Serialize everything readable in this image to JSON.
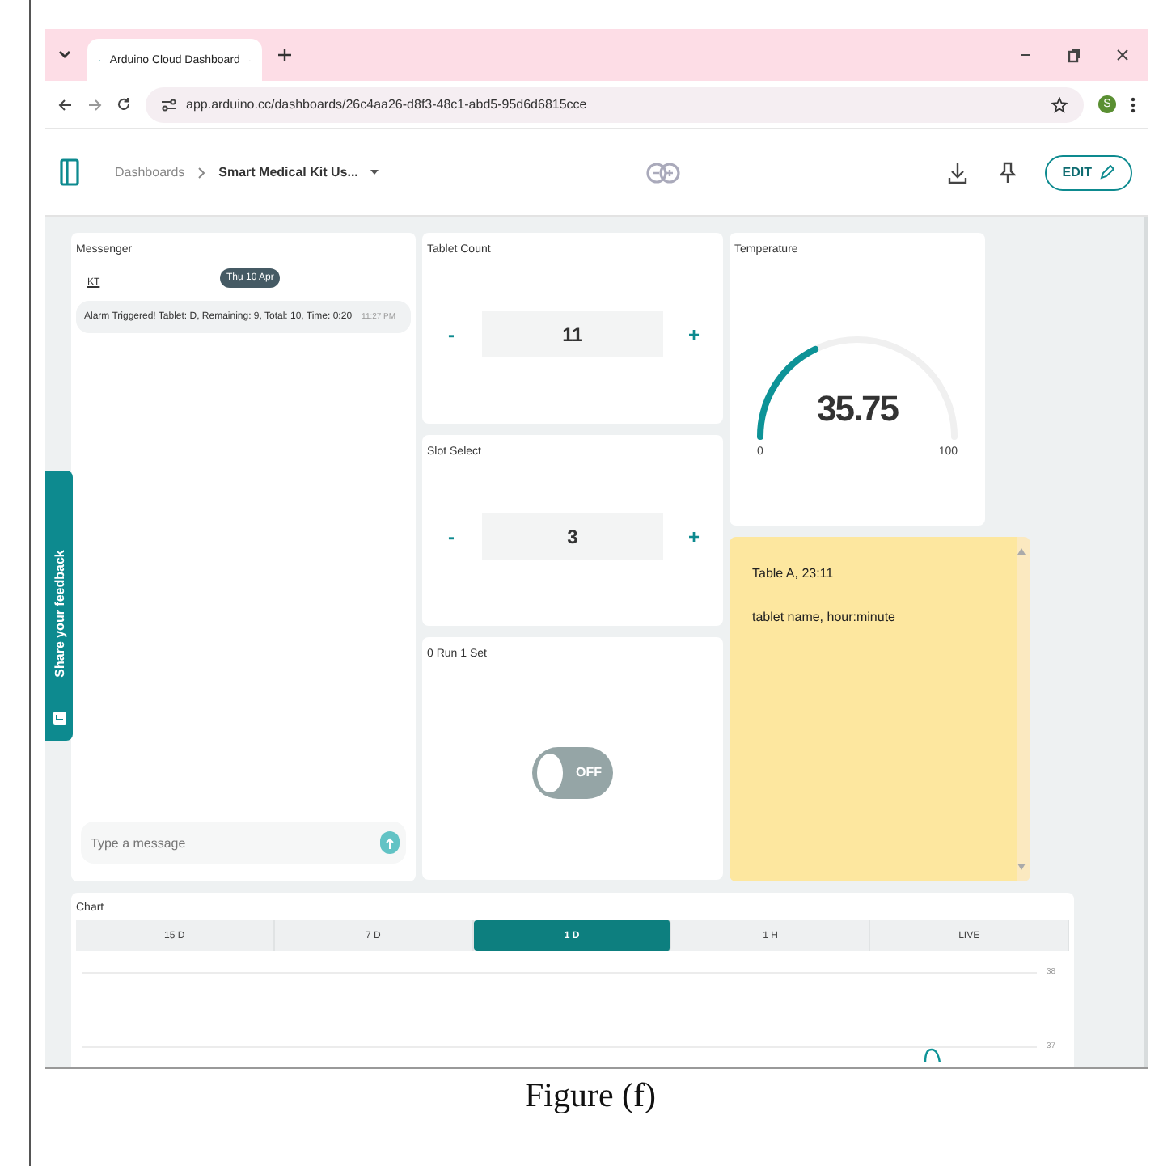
{
  "browser": {
    "tab_title": "Arduino Cloud Dashboard",
    "url": "app.arduino.cc/dashboards/26c4aa26-d8f3-48c1-abd5-95d6d6815cce",
    "profile": "S"
  },
  "header": {
    "breadcrumb": "Dashboards",
    "dashboard": "Smart Medical Kit Us...",
    "edit": "EDIT"
  },
  "messenger": {
    "title": "Messenger",
    "date": "Thu 10 Apr",
    "sender": "KT",
    "message": "Alarm Triggered! Tablet: D, Remaining: 9, Total: 10, Time: 0:20",
    "time": "11:27 PM",
    "placeholder": "Type a message"
  },
  "steppers": [
    {
      "title": "Tablet Count",
      "minus": "-",
      "value": "11",
      "plus": "+"
    },
    {
      "title": "Slot Select",
      "minus": "-",
      "value": "3",
      "plus": "+"
    }
  ],
  "switch": {
    "title": "0 Run 1 Set",
    "on": false,
    "label": "OFF"
  },
  "gauge": {
    "title": "Temperature",
    "value": "35.75",
    "min": "0",
    "max": "100"
  },
  "note": {
    "lines": [
      "Table A, 23:11",
      "tablet name, hour:minute"
    ]
  },
  "feedback": {
    "label": "Share your feedback"
  },
  "chart": {
    "title": "Chart",
    "ranges": [
      {
        "label": "15 D",
        "selected": false
      },
      {
        "label": "7 D",
        "selected": false
      },
      {
        "label": "1 D",
        "selected": true
      },
      {
        "label": "1 H",
        "selected": false
      },
      {
        "label": "LIVE",
        "selected": false
      }
    ],
    "y_labels": [
      "38",
      "37"
    ]
  },
  "caption": "Figure (f)"
}
